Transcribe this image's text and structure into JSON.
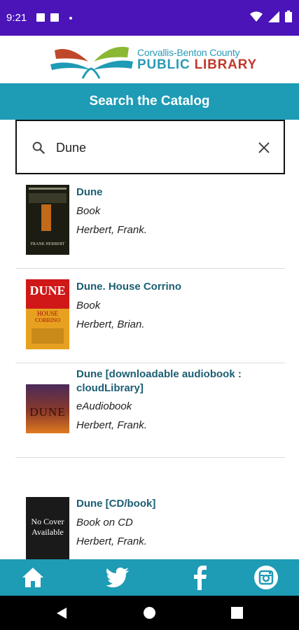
{
  "status_bar": {
    "time": "9:21"
  },
  "header": {
    "logo_line1": "Corvallis-Benton County",
    "logo_public": "PUBLIC",
    "logo_library": "LIBRARY"
  },
  "page_title": "Search the Catalog",
  "search": {
    "value": "Dune"
  },
  "results": [
    {
      "title": "Dune",
      "format": "Book",
      "author": "Herbert, Frank."
    },
    {
      "title": "Dune. House Corrino",
      "format": "Book",
      "author": "Herbert, Brian."
    },
    {
      "title_line1": "Dune [downloadable audiobook :",
      "title_line2": "cloudLibrary]",
      "format": "eAudiobook",
      "author": "Herbert, Frank."
    },
    {
      "title": "Dune [CD/book]",
      "format": "Book on CD",
      "author": "Herbert, Frank."
    }
  ],
  "covers": {
    "dune1_author": "FRANK HERBERT",
    "corrino_word1": "DUNE",
    "corrino_word2": "HOUSE",
    "corrino_word3": "CORRINO",
    "audio_word": "DUNE",
    "nocover_line1": "No Cover",
    "nocover_line2": "Available"
  },
  "colors": {
    "status_bar": "#4a14b8",
    "brand_teal": "#1e9bb5",
    "title_text": "#1b5e73",
    "library_red": "#c0392b"
  },
  "bottom_nav": [
    "home-icon",
    "twitter-icon",
    "facebook-icon",
    "instagram-icon"
  ]
}
